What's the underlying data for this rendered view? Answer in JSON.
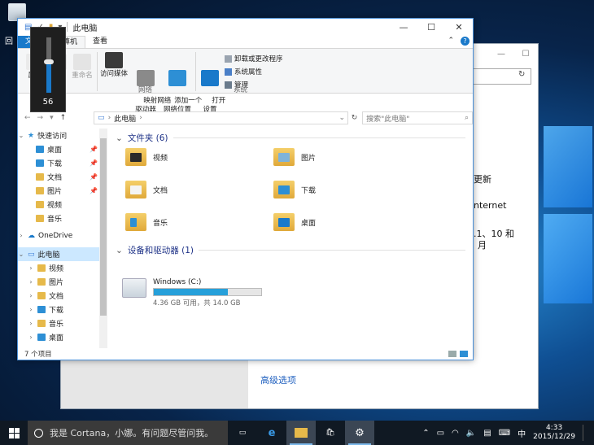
{
  "desktop": {
    "recycle_label": "回"
  },
  "bg_window": {
    "text1": "更新",
    "text2": "nternet",
    "text3": ".1、10 和",
    "text4": "月",
    "advanced_link": "高级选项"
  },
  "explorer": {
    "title": "此电脑",
    "tabs": {
      "file": "文件",
      "computer": "计算机",
      "view": "查看"
    },
    "ribbon": {
      "properties": "属性",
      "open": "打开",
      "rename": "重命名",
      "access_media": "访问媒体",
      "map_drive": "映射网络\n驱动器",
      "add_location": "添加一个\n网络位置",
      "open_settings": "打开\n设置",
      "uninstall": "卸载或更改程序",
      "system_props": "系统属性",
      "manage": "管理",
      "group_location": "位置",
      "group_network": "网络",
      "group_system": "系统"
    },
    "address": {
      "path_item": "此电脑",
      "search_placeholder": "搜索\"此电脑\""
    },
    "nav": {
      "quick_access": "快速访问",
      "quick_items": [
        "桌面",
        "下载",
        "文档",
        "图片",
        "视频",
        "音乐"
      ],
      "onedrive": "OneDrive",
      "this_pc": "此电脑",
      "pc_items": [
        "视频",
        "图片",
        "文档",
        "下载",
        "音乐",
        "桌面"
      ]
    },
    "folders_header": "文件夹 (6)",
    "folders": [
      "视频",
      "图片",
      "文档",
      "下载",
      "音乐",
      "桌面"
    ],
    "devices_header": "设备和驱动器 (1)",
    "drive": {
      "name": "Windows (C:)",
      "free_text": "4.36 GB 可用，共 14.0 GB",
      "used_fraction": 0.689
    },
    "status": "7 个项目"
  },
  "volume": {
    "level": 56
  },
  "taskbar": {
    "cortana_text": "我是 Cortana，小娜。有问题尽管问我。",
    "ime": "中",
    "time": "4:33",
    "date": "2015/12/29"
  },
  "colors": {
    "accent": "#1979ca",
    "drive_fill": "#26a0da",
    "taskbar": "#101923"
  }
}
